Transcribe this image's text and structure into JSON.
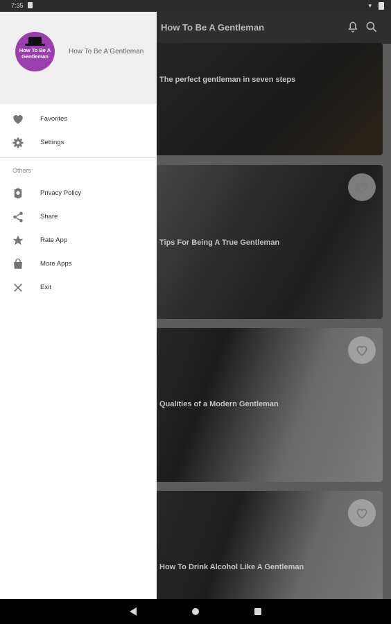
{
  "status_bar": {
    "time": "7:35"
  },
  "app_bar": {
    "title": "How To Be A Gentleman"
  },
  "cards": [
    {
      "title": "The perfect gentleman in seven steps"
    },
    {
      "title": "Tips For Being A True Gentleman"
    },
    {
      "title": "Qualities of a Modern Gentleman"
    },
    {
      "title": "How To Drink Alcohol Like A Gentleman"
    }
  ],
  "drawer": {
    "logo_text": "How To Be A Gentleman",
    "app_name": "How To Be A Gentleman",
    "primary_items": [
      {
        "label": "Favorites",
        "icon": "heart-icon"
      },
      {
        "label": "Settings",
        "icon": "gear-icon"
      }
    ],
    "section_label": "Others",
    "other_items": [
      {
        "label": "Privacy Policy",
        "icon": "badge-icon"
      },
      {
        "label": "Share",
        "icon": "share-icon"
      },
      {
        "label": "Rate App",
        "icon": "star-icon"
      },
      {
        "label": "More Apps",
        "icon": "shopping-bag-icon"
      },
      {
        "label": "Exit",
        "icon": "close-icon"
      }
    ]
  },
  "colors": {
    "brand_purple": "#9b3fb0",
    "drawer_bg": "#ffffff",
    "header_bg": "#efefef",
    "scrim": "#5e5e5e"
  }
}
